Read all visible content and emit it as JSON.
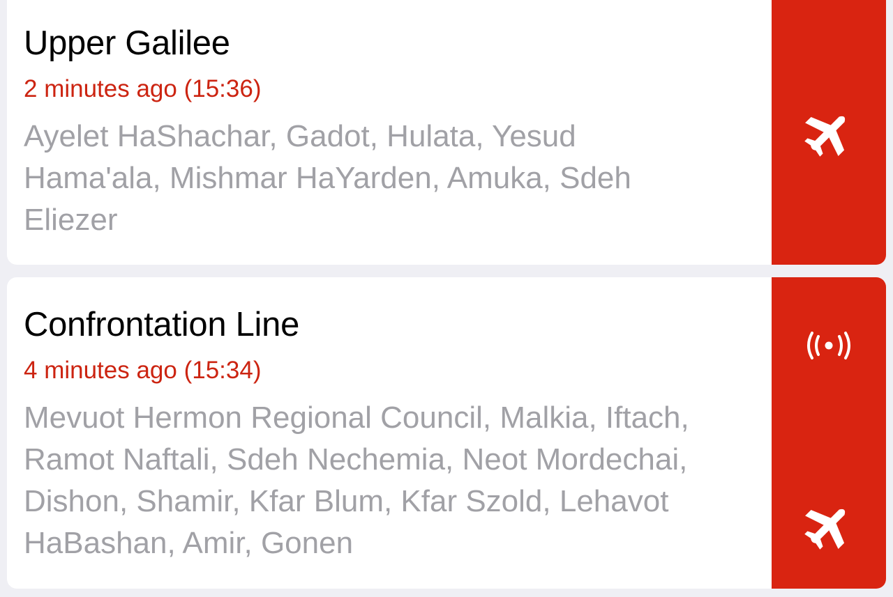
{
  "theme": {
    "accent_red": "#d92411",
    "time_red": "#cc2411",
    "area_gray": "#a1a1a6",
    "background": "#efeff4"
  },
  "alerts": [
    {
      "region": "Upper Galilee",
      "time": "2 minutes ago (15:36)",
      "areas": "Ayelet HaShachar, Gadot, Hulata, Yesud Hama'ala, Mishmar HaYarden, Amuka, Sdeh Eliezer",
      "icons": [
        "airplane-icon"
      ]
    },
    {
      "region": "Confrontation Line",
      "time": "4 minutes ago (15:34)",
      "areas": "Mevuot Hermon Regional Council, Malkia, Iftach, Ramot Naftali, Sdeh Nechemia, Neot Mordechai, Dishon, Shamir, Kfar Blum, Kfar Szold, Lehavot HaBashan, Amir, Gonen",
      "icons": [
        "broadcast-icon",
        "airplane-icon"
      ]
    }
  ]
}
